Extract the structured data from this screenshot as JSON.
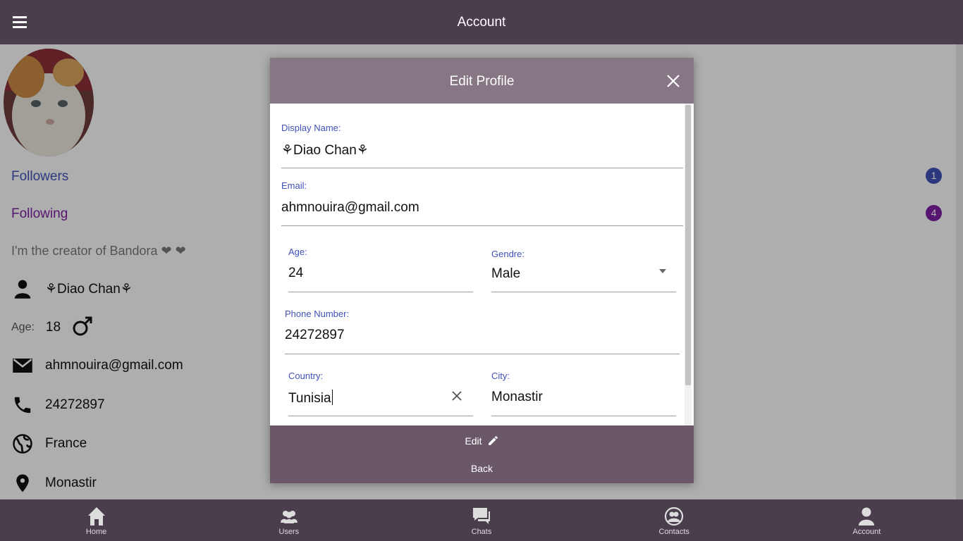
{
  "header": {
    "title": "Account",
    "menu_icon": "hamburger-menu-icon"
  },
  "profile": {
    "followers_label": "Followers",
    "followers_count": "1",
    "following_label": "Following",
    "following_count": "4",
    "bio": "I'm the creator of Bandora ❤ ❤",
    "display_name": "⚘Diao Chan⚘",
    "age_label": "Age:",
    "age": "18",
    "gender_icon": "male-symbol-icon",
    "email": "ahmnouira@gmail.com",
    "phone": "24272897",
    "country": "France",
    "city": "Monastir"
  },
  "modal": {
    "title": "Edit Profile",
    "fields": {
      "display_name": {
        "label": "Display Name:",
        "value": "⚘Diao Chan⚘"
      },
      "email": {
        "label": "Email:",
        "value": "ahmnouira@gmail.com"
      },
      "age": {
        "label": "Age:",
        "value": "24"
      },
      "gender": {
        "label": "Gendre:",
        "value": "Male"
      },
      "phone": {
        "label": "Phone Number:",
        "value": "24272897"
      },
      "country": {
        "label": "Country:",
        "value": "Tunisia"
      },
      "city": {
        "label": "City:",
        "value": "Monastir"
      }
    },
    "edit_label": "Edit",
    "back_label": "Back"
  },
  "bottom_nav": [
    {
      "label": "Home",
      "icon": "home-icon"
    },
    {
      "label": "Users",
      "icon": "users-icon"
    },
    {
      "label": "Chats",
      "icon": "chats-icon"
    },
    {
      "label": "Contacts",
      "icon": "contacts-icon"
    },
    {
      "label": "Account",
      "icon": "account-icon"
    }
  ],
  "colors": {
    "bar_bg": "#4a3d4c",
    "modal_header": "#877785",
    "modal_footer": "#6a5869",
    "followers_blue": "#3f51b5",
    "following_purple": "#7b1fa2"
  }
}
